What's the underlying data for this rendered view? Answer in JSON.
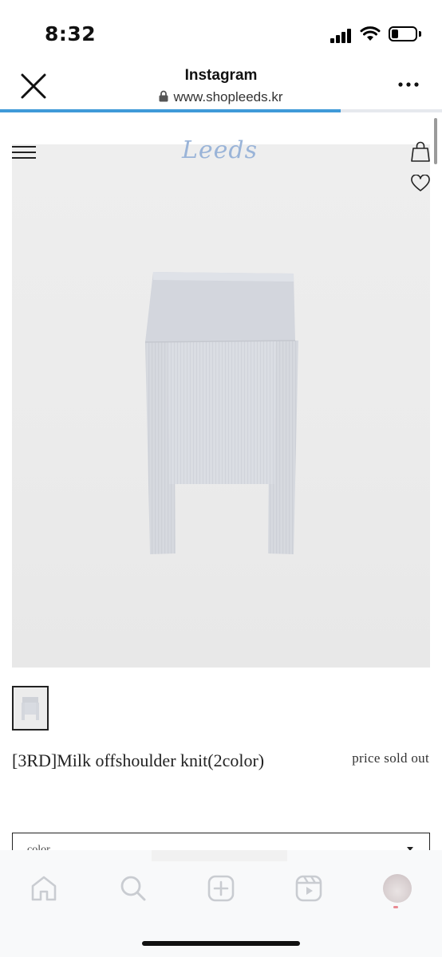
{
  "status_bar": {
    "time": "8:32",
    "icons": [
      "cellular-signal-icon",
      "wifi-icon",
      "battery-icon"
    ],
    "battery_level": 0.3
  },
  "browser": {
    "title": "Instagram",
    "url": "www.shopleeds.kr",
    "close_icon": "close-icon",
    "lock_icon": "lock-icon",
    "more_icon": "more-horizontal-icon",
    "load_progress": 0.77,
    "accent_color": "#3f9ad8"
  },
  "site": {
    "logo": "Leeds",
    "logo_color": "#9ab4d8",
    "menu_icon": "hamburger-menu-icon",
    "bag_icon": "shopping-bag-icon",
    "wishlist_icon": "heart-icon"
  },
  "product": {
    "image": "light-gray-offshoulder-knit-photo",
    "name": "[3RD]Milk offshoulder knit(2color)",
    "price": "price sold out",
    "option_select": {
      "label": "color"
    }
  },
  "tab_bar": {
    "items": [
      "home-icon",
      "search-icon",
      "create-post-icon",
      "reels-icon",
      "profile-avatar"
    ]
  }
}
